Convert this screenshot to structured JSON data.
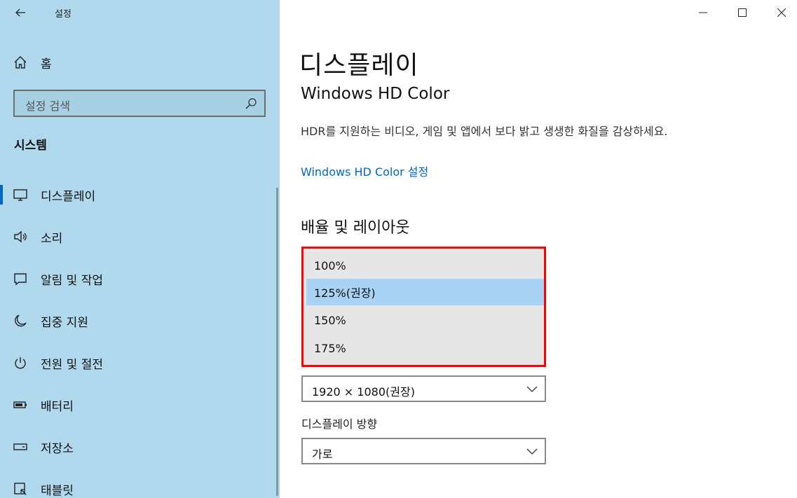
{
  "window": {
    "app_title": "설정",
    "back_icon": "back-arrow-icon"
  },
  "sidebar": {
    "home_label": "홈",
    "search_placeholder": "설정 검색",
    "section_title": "시스템",
    "items": [
      {
        "label": "디스플레이",
        "icon": "monitor-icon",
        "selected": true
      },
      {
        "label": "소리",
        "icon": "speaker-icon",
        "selected": false
      },
      {
        "label": "알림 및 작업",
        "icon": "notification-icon",
        "selected": false
      },
      {
        "label": "집중 지원",
        "icon": "moon-icon",
        "selected": false
      },
      {
        "label": "전원 및 절전",
        "icon": "power-icon",
        "selected": false
      },
      {
        "label": "배터리",
        "icon": "battery-icon",
        "selected": false
      },
      {
        "label": "저장소",
        "icon": "storage-icon",
        "selected": false
      },
      {
        "label": "태블릿",
        "icon": "tablet-icon",
        "selected": false
      }
    ]
  },
  "main": {
    "page_title": "디스플레이",
    "hdr": {
      "title": "Windows HD Color",
      "description": "HDR를 지원하는 비디오, 게임 및 앱에서 보다 밝고 생생한 화질을 감상하세요.",
      "link": "Windows HD Color 설정"
    },
    "scale_layout": {
      "title": "배율 및 레이아웃",
      "scale_options": [
        "100%",
        "125%(권장)",
        "150%",
        "175%"
      ],
      "scale_selected": "125%(권장)",
      "resolution_value": "1920 × 1080(권장)",
      "orientation_label": "디스플레이 방향",
      "orientation_value": "가로"
    },
    "highlight_color": "#ff0000",
    "accent_color": "#0067c0"
  }
}
